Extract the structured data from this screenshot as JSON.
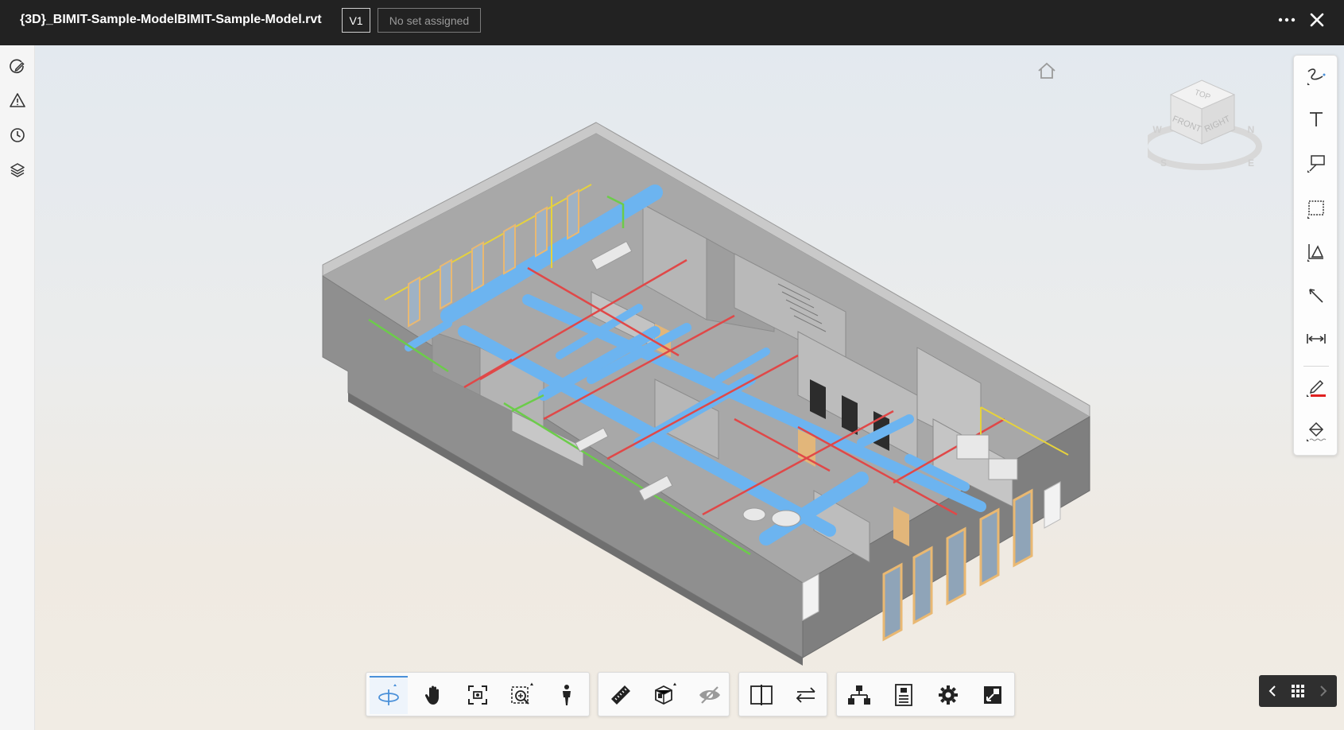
{
  "header": {
    "title": "{3D}_BIMIT-Sample-ModelBIMIT-Sample-Model.rvt",
    "version": "V1",
    "set_status": "No set assigned"
  },
  "left_rail": {
    "items": [
      {
        "icon": "markup-edit-icon"
      },
      {
        "icon": "warning-icon"
      },
      {
        "icon": "history-clock-icon"
      },
      {
        "icon": "layers-icon"
      }
    ]
  },
  "viewcube": {
    "faces": {
      "top": "TOP",
      "front": "FRONT",
      "right": "RIGHT"
    },
    "compass": {
      "north": "N",
      "south": "S",
      "east": "E",
      "west": "W"
    }
  },
  "markup_tools": [
    "freehand-pen-icon",
    "text-icon",
    "callout-icon",
    "cloud-icon",
    "polygon-icon",
    "arrow-icon",
    "dimension-icon",
    "stroke-color-icon",
    "fill-icon"
  ],
  "bottom_toolbar": {
    "navigation": [
      "orbit-icon",
      "pan-icon",
      "fit-to-view-icon",
      "zoom-window-icon",
      "first-person-icon"
    ],
    "measure": [
      "measure-icon",
      "section-box-icon",
      "hide-objects-icon"
    ],
    "compare": [
      "split-view-icon",
      "compare-arrows-icon"
    ],
    "settings": [
      "model-browser-icon",
      "properties-icon",
      "settings-gear-icon",
      "fullscreen-icon"
    ]
  },
  "colors": {
    "accent": "#4a90d9",
    "duct": "#6cb4f0",
    "pipe_red": "#e04848",
    "pipe_green": "#6ccc4a",
    "pipe_yellow": "#e6d23c",
    "window_frame": "#e9b872"
  }
}
